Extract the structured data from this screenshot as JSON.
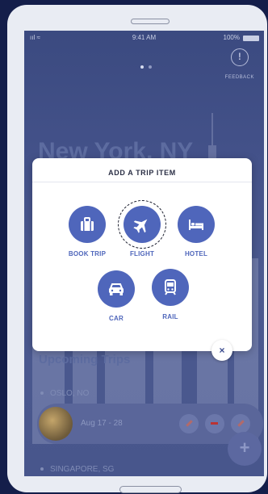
{
  "status_bar": {
    "signal": "ııl ≈",
    "time": "9:41 AM",
    "battery": "100%"
  },
  "feedback": {
    "label": "FEEDBACK",
    "icon": "feedback-icon"
  },
  "destination": {
    "city": "New York, NY"
  },
  "upcoming": {
    "title": "Upcoming Trips",
    "trips": [
      {
        "name": "OSLO, NO"
      },
      {
        "dates": "Aug 17 - 28"
      },
      {
        "name": "SINGAPORE, SG"
      }
    ]
  },
  "modal": {
    "title": "ADD A TRIP ITEM",
    "items": [
      {
        "label": "BOOK TRIP",
        "icon": "suitcase-icon"
      },
      {
        "label": "FLIGHT",
        "icon": "airplane-icon",
        "selected": true
      },
      {
        "label": "HOTEL",
        "icon": "bed-icon"
      },
      {
        "label": "CAR",
        "icon": "car-icon"
      },
      {
        "label": "RAIL",
        "icon": "train-icon"
      }
    ]
  },
  "close_button": {
    "glyph": "×"
  },
  "fab": {
    "glyph": "+"
  },
  "colors": {
    "accent": "#4f66bb",
    "backdrop": "#141e4a",
    "modal": "#ffffff"
  }
}
